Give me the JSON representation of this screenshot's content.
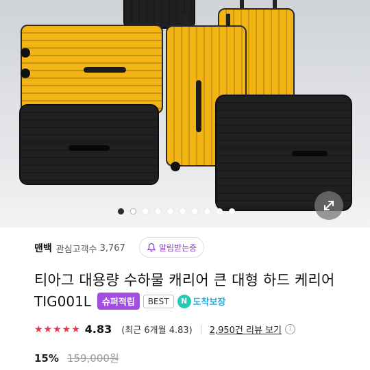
{
  "gallery": {
    "image_alt": "",
    "slide_count": 10,
    "active_index": 0
  },
  "seller": {
    "name": "맨백",
    "interest_label": "관심고객수",
    "interest_count": "3,767",
    "alert_label": "알림받는중"
  },
  "product": {
    "title": "티아그 대용량 수하물 캐리어 큰 대형 하드 케리어",
    "code": "TIG001L",
    "badges": {
      "super": "슈퍼적립",
      "best": "BEST",
      "delivery": "도착보장",
      "delivery_icon": "N"
    }
  },
  "rating": {
    "stars": "★★★★★",
    "score": "4.83",
    "recent_text": "(최근 6개월 4.83)",
    "review_link": "2,950건 리뷰 보기",
    "info_glyph": "i"
  },
  "price": {
    "discount": "15%",
    "original": "159,000원"
  },
  "colors": {
    "accent_purple": "#a44ee0",
    "star_red": "#f0324a",
    "suitcase_yellow": "#f3b515",
    "suitcase_black": "#1f2022"
  }
}
